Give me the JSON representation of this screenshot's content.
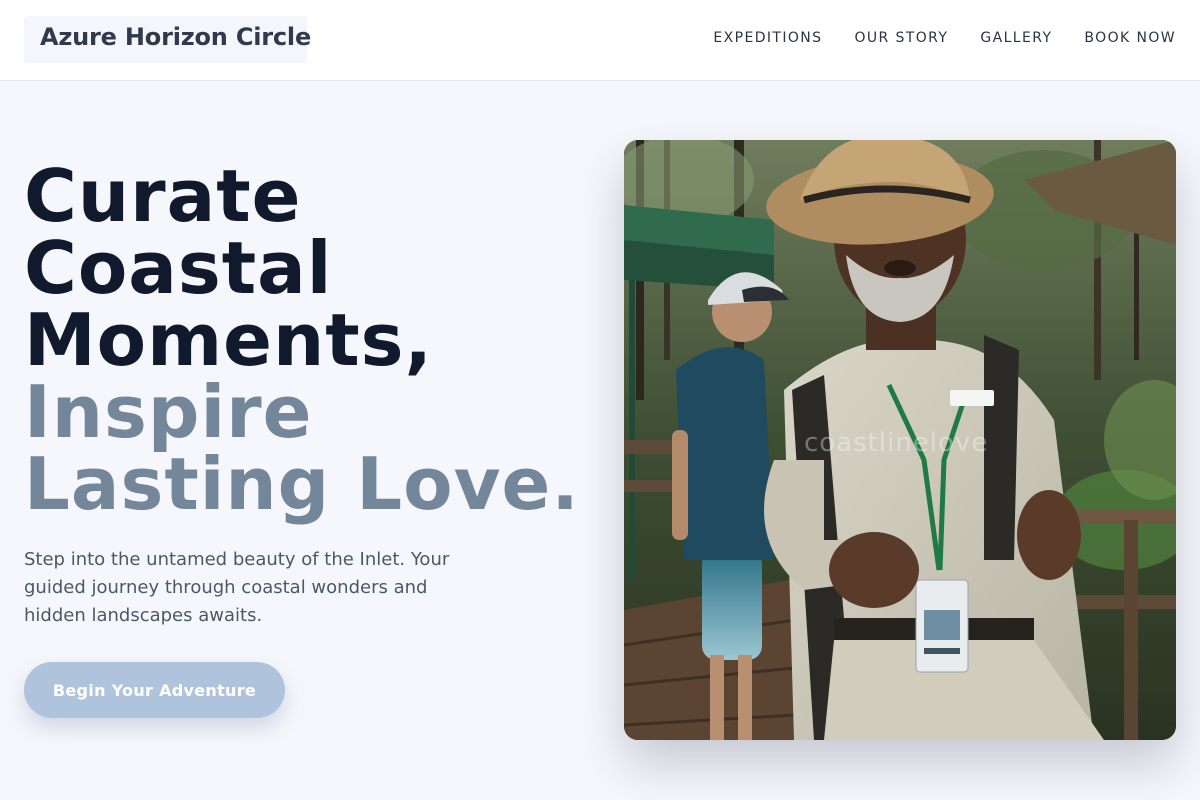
{
  "header": {
    "logo_text": "Azure Horizon Circle",
    "nav": [
      {
        "label": "EXPEDITIONS"
      },
      {
        "label": "OUR STORY"
      },
      {
        "label": "GALLERY"
      },
      {
        "label": "BOOK NOW"
      }
    ]
  },
  "hero": {
    "title_lines": [
      "Curate",
      "Coastal",
      "Moments,",
      "Inspire",
      "Lasting Love."
    ],
    "subtitle": "Step into the untamed beauty of the Inlet. Your guided journey through coastal wonders and hidden landscapes awaits.",
    "cta_label": "Begin Your Adventure"
  },
  "photo": {
    "watermark": "coastlinelove",
    "badge_name": "Lamb"
  },
  "colors": {
    "background": "#f6f7fc",
    "title_dark": "#111a2c",
    "title_muted": "#74869a",
    "cta": "#b0c3dd"
  }
}
